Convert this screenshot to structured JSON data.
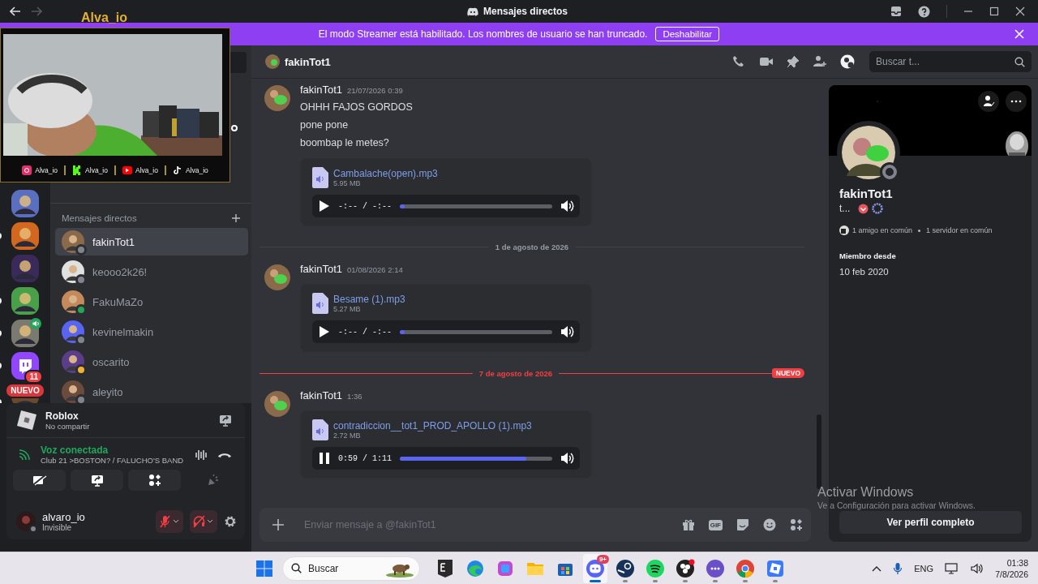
{
  "title_bar": {
    "title": "Mensajes directos"
  },
  "streamer_banner": {
    "text": "El modo Streamer está habilitado. Los nombres de usuario se han truncado.",
    "button": "Deshabilitar"
  },
  "webcam_overlay": {
    "channel_name": "Alva_io",
    "socials": [
      {
        "kind": "instagram",
        "handle": "Alva_io"
      },
      {
        "kind": "kick",
        "handle": "Alva_io"
      },
      {
        "kind": "youtube",
        "handle": "Alva_io"
      },
      {
        "kind": "tiktok",
        "handle": "Alva_io"
      }
    ]
  },
  "servers": [
    {
      "unread": false
    },
    {
      "unread": true
    },
    {
      "unread": false
    },
    {
      "unread": true
    },
    {
      "unread": true,
      "in_voice": true
    },
    {
      "unread": true,
      "badge": "11",
      "kind": "twitch"
    },
    {
      "unread": true
    }
  ],
  "new_pill": "NUEVO",
  "dm": {
    "header": "Mensajes directos",
    "items": [
      {
        "name": "fakinTot1",
        "selected": true,
        "color": "#80848e"
      },
      {
        "name": "keooo2k26!",
        "selected": false,
        "color": "#80848e"
      },
      {
        "name": "FakuMaZo",
        "selected": false,
        "color": "#23a55a"
      },
      {
        "name": "kevinelmakin",
        "selected": false,
        "color": "#80848e"
      },
      {
        "name": "oscarito",
        "selected": false,
        "color": "#f0b232"
      },
      {
        "name": "aleyito",
        "selected": false,
        "color": "#80848e"
      }
    ]
  },
  "activity": {
    "game": "Roblox",
    "detail": "No compartir"
  },
  "voice": {
    "status": "Voz conectada",
    "channel": "Club 21 >BOSTON? / FALUCHO'S BAND"
  },
  "user": {
    "name": "alvaro_io",
    "status": "Invisible",
    "mic_muted": true,
    "deafened": true
  },
  "chat": {
    "header_name": "fakinTot1",
    "search_placeholder": "Buscar t...",
    "items": [
      {
        "kind": "message",
        "author": "fakinTot1",
        "time": "21/07/2026 0:39",
        "lines": [
          "OHHH FAJOS GORDOS",
          "pone pone",
          "boombap le metes?"
        ],
        "attachment": {
          "name": "Cambalache(open).mp3",
          "size": "5.95 MB",
          "playing": false,
          "time": "-:-- / -:--",
          "level": 0.0
        }
      },
      {
        "kind": "divider",
        "label": "1 de agosto de 2026",
        "new": false
      },
      {
        "kind": "message",
        "author": "fakinTot1",
        "time": "01/08/2026 2:14",
        "attachment": {
          "name": "Besame (1).mp3",
          "size": "5.27 MB",
          "playing": false,
          "time": "-:-- / -:--",
          "level": 0.0
        }
      },
      {
        "kind": "divider",
        "label": "7 de agosto de 2026",
        "new": true,
        "badge": "NUEVO"
      },
      {
        "kind": "message",
        "author": "fakinTot1",
        "time": "1:36",
        "attachment": {
          "name": "contradiccion__tot1_PROD_APOLLO (1).mp3",
          "size": "2.72 MB",
          "playing": true,
          "time": "0:59 / 1:11",
          "level": 0.83
        }
      }
    ],
    "composer_placeholder": "Enviar mensaje a @fakinTot1",
    "gif_label": "GIF"
  },
  "profile": {
    "name": "fakinTot1",
    "tag": "t...",
    "mutual_friends": "1 amigo en común",
    "mutual_servers": "1 servidor en común",
    "member_since_label": "Miembro desde",
    "member_since": "10 feb 2020",
    "button": "Ver perfil completo"
  },
  "watermark": {
    "title": "Activar Windows",
    "subtitle": "Ve a Configuración para activar Windows."
  },
  "taskbar": {
    "search_placeholder": "Buscar",
    "apps": [
      {
        "kind": "epic",
        "running": false,
        "active": false
      },
      {
        "kind": "edge",
        "running": false,
        "active": false
      },
      {
        "kind": "office",
        "running": false,
        "active": false
      },
      {
        "kind": "files",
        "running": false,
        "active": false
      },
      {
        "kind": "store",
        "running": false,
        "active": false
      },
      {
        "kind": "discord",
        "running": true,
        "active": true,
        "badge": "9+"
      },
      {
        "kind": "steam",
        "running": true,
        "active": false
      },
      {
        "kind": "spotify",
        "running": true,
        "active": false
      },
      {
        "kind": "obs",
        "running": true,
        "active": false
      },
      {
        "kind": "chat",
        "running": true,
        "active": false
      },
      {
        "kind": "chrome",
        "running": true,
        "active": false
      },
      {
        "kind": "roblox",
        "running": true,
        "active": false
      }
    ],
    "language": "ENG",
    "time": "01:38",
    "date": "7/8/2026"
  }
}
